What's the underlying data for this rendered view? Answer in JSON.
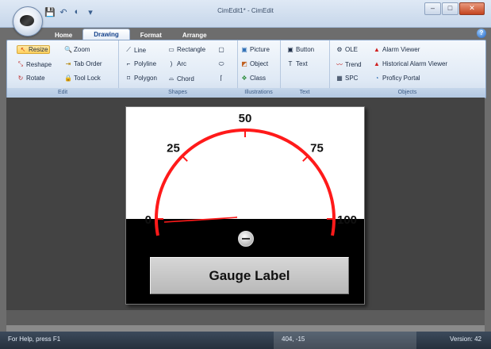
{
  "window": {
    "title": "CimEdit1* - CimEdit",
    "controls": {
      "minimize": "–",
      "maximize": "□",
      "close": "✕"
    }
  },
  "qat": {
    "save_icon": "save-icon",
    "undo_icon": "undo-icon",
    "redo_icon": "redo-icon",
    "customize_icon": "dropdown-arrow-icon"
  },
  "tabs": [
    {
      "label": "Home"
    },
    {
      "label": "Drawing"
    },
    {
      "label": "Format"
    },
    {
      "label": "Arrange"
    }
  ],
  "ribbon": {
    "edit": {
      "label": "Edit",
      "resize": "Resize",
      "zoom": "Zoom",
      "reshape": "Reshape",
      "tab_order": "Tab Order",
      "rotate": "Rotate",
      "tool_lock": "Tool Lock"
    },
    "shapes": {
      "label": "Shapes",
      "line": "Line",
      "rectangle": "Rectangle",
      "polyline": "Polyline",
      "arc": "Arc",
      "polygon": "Polygon",
      "chord": "Chord"
    },
    "illustrations": {
      "label": "Illustrations",
      "picture": "Picture",
      "object": "Object",
      "class": "Class"
    },
    "text": {
      "label": "Text",
      "button": "Button",
      "text": "Text"
    },
    "objects": {
      "label": "Objects",
      "ole": "OLE",
      "alarm_viewer": "Alarm Viewer",
      "trend": "Trend",
      "historical_alarm_viewer": "Historical Alarm Viewer",
      "spc": "SPC",
      "proficy_portal": "Proficy Portal"
    }
  },
  "gauge": {
    "ticks": [
      "0",
      "25",
      "50",
      "75",
      "100"
    ],
    "value": 0,
    "min": 0,
    "max": 100,
    "label": "Gauge Label",
    "colors": {
      "arc": "#ff1a1a",
      "face": "#ffffff",
      "body": "#000000"
    }
  },
  "status": {
    "help": "For Help, press F1",
    "coords": "404, -15",
    "version": "Version: 42"
  }
}
